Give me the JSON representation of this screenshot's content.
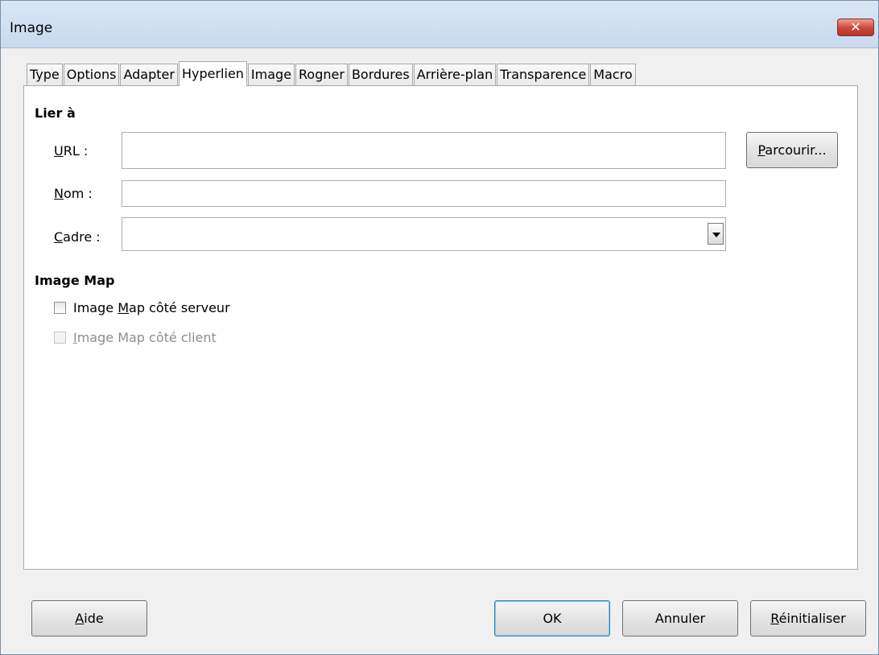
{
  "window": {
    "title": "Image",
    "close_glyph": "✕"
  },
  "tabs": [
    {
      "label": "Type",
      "active": false
    },
    {
      "label": "Options",
      "active": false
    },
    {
      "label": "Adapter",
      "active": false
    },
    {
      "label": "Hyperlien",
      "active": true
    },
    {
      "label": "Image",
      "active": false
    },
    {
      "label": "Rogner",
      "active": false
    },
    {
      "label": "Bordures",
      "active": false
    },
    {
      "label": "Arrière-plan",
      "active": false
    },
    {
      "label": "Transparence",
      "active": false
    },
    {
      "label": "Macro",
      "active": false
    }
  ],
  "link": {
    "section_title": "Lier à",
    "url_label_mnemonic": "U",
    "url_label_rest": "RL :",
    "url_value": "",
    "name_label_mnemonic": "N",
    "name_label_rest": "om :",
    "name_value": "",
    "frame_label_mnemonic": "C",
    "frame_label_rest": "adre :",
    "frame_value": "",
    "browse_mnemonic": "P",
    "browse_rest": "arcourir..."
  },
  "imagemap": {
    "section_title": "Image Map",
    "server_pre": "Image ",
    "server_mnemonic": "M",
    "server_post": "ap côté serveur",
    "server_checked": false,
    "client_pre": "",
    "client_mnemonic": "I",
    "client_post": "mage Map côté client",
    "client_checked": false,
    "client_enabled": false
  },
  "buttons": {
    "help_mnemonic": "A",
    "help_rest": "ide",
    "ok": "OK",
    "cancel": "Annuler",
    "reset_mnemonic": "R",
    "reset_rest": "éinitialiser"
  },
  "colors": {
    "title_bar": "#c9d9ee",
    "close": "#c8473a",
    "default_border": "#3c7fb1"
  }
}
